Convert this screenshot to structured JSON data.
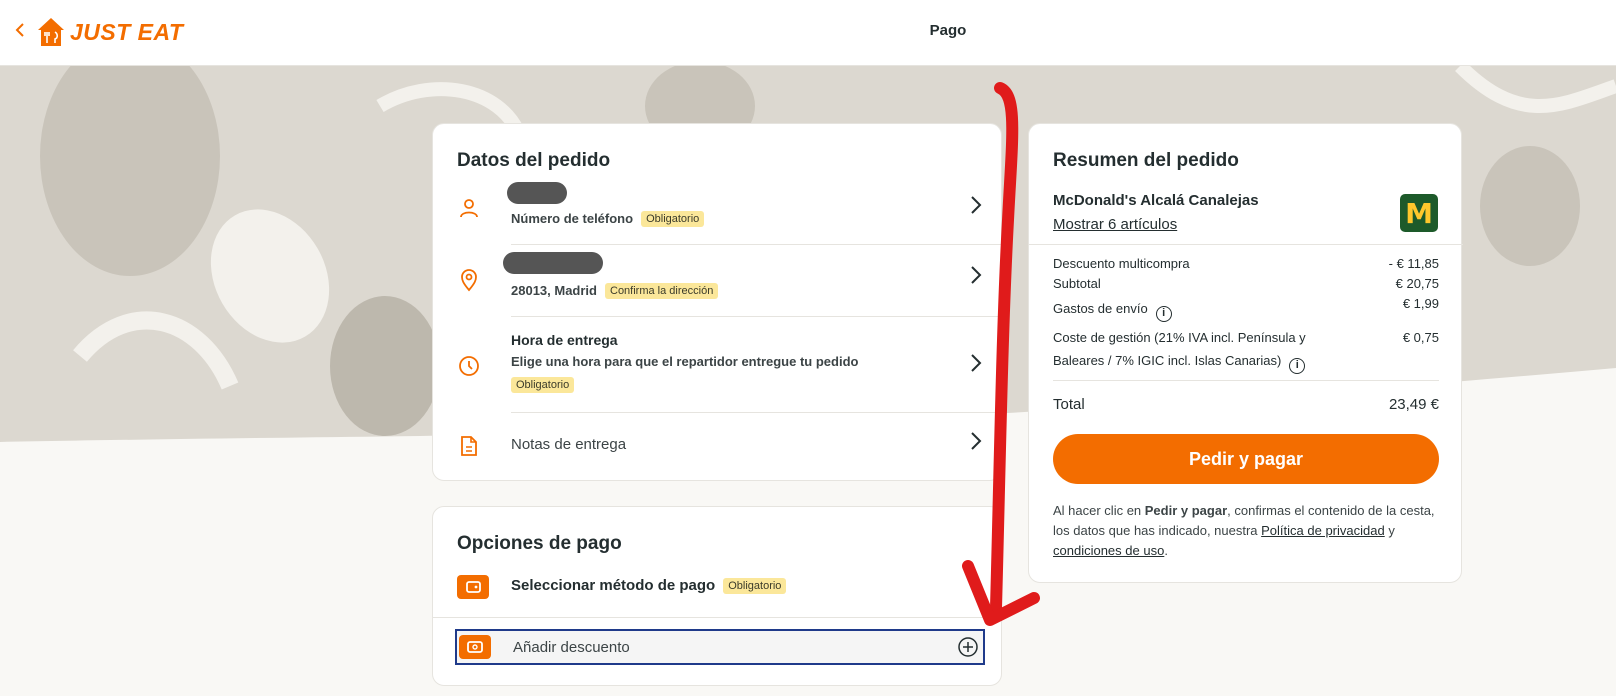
{
  "header": {
    "brand": "JUST EAT",
    "title": "Pago"
  },
  "order_details": {
    "heading": "Datos del pedido",
    "phone": {
      "label": "Número de teléfono",
      "badge": "Obligatorio"
    },
    "address": {
      "label": "28013, Madrid",
      "badge": "Confirma la dirección"
    },
    "delivery_time": {
      "title": "Hora de entrega",
      "description": "Elige una hora para que el repartidor entregue tu pedido",
      "badge": "Obligatorio"
    },
    "notes": {
      "label": "Notas de entrega"
    }
  },
  "payment": {
    "heading": "Opciones de pago",
    "method": {
      "label": "Seleccionar método de pago",
      "badge": "Obligatorio"
    },
    "discount": {
      "label": "Añadir descuento"
    }
  },
  "summary": {
    "heading": "Resumen del pedido",
    "restaurant": "McDonald's Alcalá Canalejas",
    "show_items": "Mostrar 6 artículos",
    "logo_letter": "M",
    "lines": [
      {
        "label": "Descuento multicompra",
        "value": "- € 11,85"
      },
      {
        "label": "Subtotal",
        "value": "€ 20,75"
      },
      {
        "label": "Gastos de envío",
        "value": "€ 1,99"
      },
      {
        "label": "Coste de gestión (21% IVA incl. Península y",
        "label2": "Baleares / 7% IGIC incl. Islas Canarias)",
        "value": "€ 0,75"
      }
    ],
    "total_label": "Total",
    "total_value": "23,49 €",
    "cta": "Pedir y pagar",
    "legal": {
      "p1": "Al hacer clic en ",
      "bold": "Pedir y pagar",
      "p2": ", confirmas el contenido de la cesta, los datos que has indicado, nuestra ",
      "link1": "Política de privacidad",
      "p3": " y ",
      "link2": "condiciones de uso",
      "p4": "."
    }
  },
  "colors": {
    "brand": "#f36d00",
    "badge": "#fbe79a",
    "annotation": "#e01b1b",
    "focus": "#1f3a8a"
  }
}
